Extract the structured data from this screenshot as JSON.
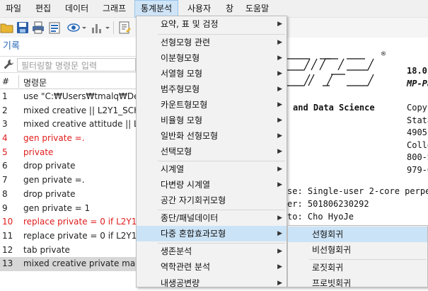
{
  "menubar": {
    "items": [
      {
        "label": "파일"
      },
      {
        "label": "편집"
      },
      {
        "label": "데이터"
      },
      {
        "label": "그래프"
      },
      {
        "label": "통계분석"
      },
      {
        "label": "사용자"
      },
      {
        "label": "창"
      },
      {
        "label": "도움말"
      }
    ]
  },
  "history_pane": {
    "title": "기록",
    "filter_placeholder": "필터링할 명령문 입력",
    "columns": [
      "#",
      "명령문"
    ],
    "rows": [
      {
        "n": "1",
        "cmd": "use \"C:₩Users₩tmalq₩Deskto"
      },
      {
        "n": "2",
        "cmd": "mixed creative || L2Y1_SCHID"
      },
      {
        "n": "3",
        "cmd": "mixed creative attitude || L2Y"
      },
      {
        "n": "4",
        "cmd": "gen private =."
      },
      {
        "n": "5",
        "cmd": "private"
      },
      {
        "n": "6",
        "cmd": "drop private"
      },
      {
        "n": "7",
        "cmd": "gen private =."
      },
      {
        "n": "8",
        "cmd": "drop private"
      },
      {
        "n": "9",
        "cmd": "gen private = 1"
      },
      {
        "n": "10",
        "cmd": "replace private = 0 if L2Y1_SC"
      },
      {
        "n": "11",
        "cmd": "replace private = 0 if L2Y1_SC"
      },
      {
        "n": "12",
        "cmd": "tab private"
      },
      {
        "n": "13",
        "cmd": "mixed creative private manag"
      }
    ]
  },
  "results": {
    "reg": "®",
    "version": "18.0",
    "edition": "MP-Pa",
    "and_ds": "and Data Science",
    "copy": "Copyr",
    "stata": "Stata",
    "l4905": "4905",
    "colle": "Colle",
    "p800": "800-S",
    "p979": "979-6",
    "license": "se: Single-user 2-core  perpe",
    "serial": "er: 501806230292",
    "licensed_to": "to: Cho HyoJe"
  },
  "stats_menu": {
    "items": [
      {
        "label": "요약, 표 및 검정",
        "sub": true
      },
      {
        "label": "선형모형 관련",
        "sub": true
      },
      {
        "label": "이분형모형",
        "sub": true
      },
      {
        "label": "서열형 모형",
        "sub": true
      },
      {
        "label": "범주형모형",
        "sub": true
      },
      {
        "label": "카운트형모형",
        "sub": true
      },
      {
        "label": "비율형 모형",
        "sub": true
      },
      {
        "label": "일반화 선형모형",
        "sub": true
      },
      {
        "label": "선택모형",
        "sub": true
      },
      {
        "label": "시계열",
        "sub": true
      },
      {
        "label": "다변량 시계열",
        "sub": true
      },
      {
        "label": "공간 자기회귀모형",
        "sub": false
      },
      {
        "label": "종단/패널데이터",
        "sub": true
      },
      {
        "label": "다중 혼합효과모형",
        "sub": true
      },
      {
        "label": "생존분석",
        "sub": true
      },
      {
        "label": "역학관련 분석",
        "sub": true
      },
      {
        "label": "내생공변량",
        "sub": true
      }
    ]
  },
  "mixed_submenu": {
    "items": [
      {
        "label": "선형회귀"
      },
      {
        "label": "비선형회귀"
      },
      {
        "label": "로짓회귀"
      },
      {
        "label": "프로빗회귀"
      }
    ]
  },
  "colors": {
    "accent": "#2a6ab8",
    "menu_highlight": "#cbe3f6",
    "error_red": "#e01c1c"
  }
}
